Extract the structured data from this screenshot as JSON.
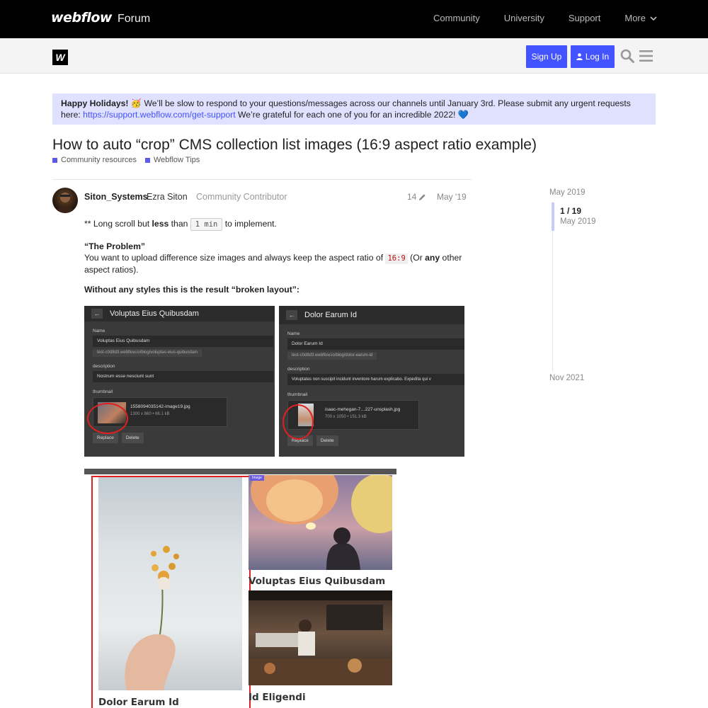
{
  "topbar": {
    "logo": "webflow",
    "forum": "Forum",
    "nav": [
      "Community",
      "University",
      "Support",
      "More"
    ]
  },
  "header": {
    "logo_letter": "W",
    "signup": "Sign Up",
    "login": "Log In",
    "icons": [
      "search-icon",
      "hamburger-menu-icon"
    ]
  },
  "banner": {
    "bold": "Happy Holidays!",
    "emoji1": "🥳",
    "text1": " We’ll be slow to respond to your questions/messages across our channels until January 3rd. Please submit any urgent requests here: ",
    "link": "https://support.webflow.com/get-support",
    "text2": " We’re grateful for each one of you for an incredible 2022! ",
    "emoji2": "💙"
  },
  "topic": {
    "title": "How to auto “crop” CMS collection list images (16:9 aspect ratio example)",
    "categories": [
      "Community resources",
      "Webflow Tips"
    ]
  },
  "post": {
    "username": "Siton_Systems",
    "full_name": "Ezra Siton",
    "user_title": "Community Contributor",
    "edit_count": "14",
    "date": "May '19",
    "line1_a": "** Long scroll but ",
    "line1_b": "less",
    "line1_c": " than ",
    "line1_code": "1 min",
    "line1_d": " to implement.",
    "problem_heading": "“The Problem”",
    "problem_a": "You want to upload difference size images and always keep the aspect ratio of ",
    "problem_code": "16:9",
    "problem_b": " (Or ",
    "problem_bold": "any",
    "problem_c": " other aspect ratios).",
    "broken_heading": "Without any styles this is the result “broken layout”:"
  },
  "screenshots": [
    {
      "title": "Voluptas Eius Quibusdam",
      "name_label": "Name",
      "name_value": "Voluptas Eius Quibusdam",
      "slug": "test-c0d8d3.webflow.io/blog/voluptas-eius-quibusdam",
      "desc_label": "description",
      "desc_value": "Nostrum esse nesciunt sunt",
      "thumb_label": "thumbnail",
      "file": "1558094035142-image19.jpg",
      "meta": "1300 x 860 • 66.1 kB",
      "replace": "Replace",
      "delete": "Delete"
    },
    {
      "title": "Dolor Earum Id",
      "name_label": "Name",
      "name_value": "Dolor Earum Id",
      "slug": "test-c0d8d3.webflow.io/blog/dolor-earum-id",
      "desc_label": "description",
      "desc_value": "Voluptates non suscipit incidunt inventore harum explicabo. Expedita qui v",
      "thumb_label": "thumbnail",
      "file": "isaac-mehegan-7…227-unsplash.jpg",
      "meta": "700 x 1050 • 151.3 kB",
      "replace": "Replace",
      "delete": "Delete"
    }
  ],
  "preview": {
    "badge": "Image",
    "captions": [
      "Dolor Earum Id",
      "Voluptas Eius Quibusdam",
      "Id Eligendi"
    ]
  },
  "timeline": {
    "start": "May 2019",
    "position": "1 / 19",
    "position_date": "May 2019",
    "end": "Nov 2021"
  }
}
